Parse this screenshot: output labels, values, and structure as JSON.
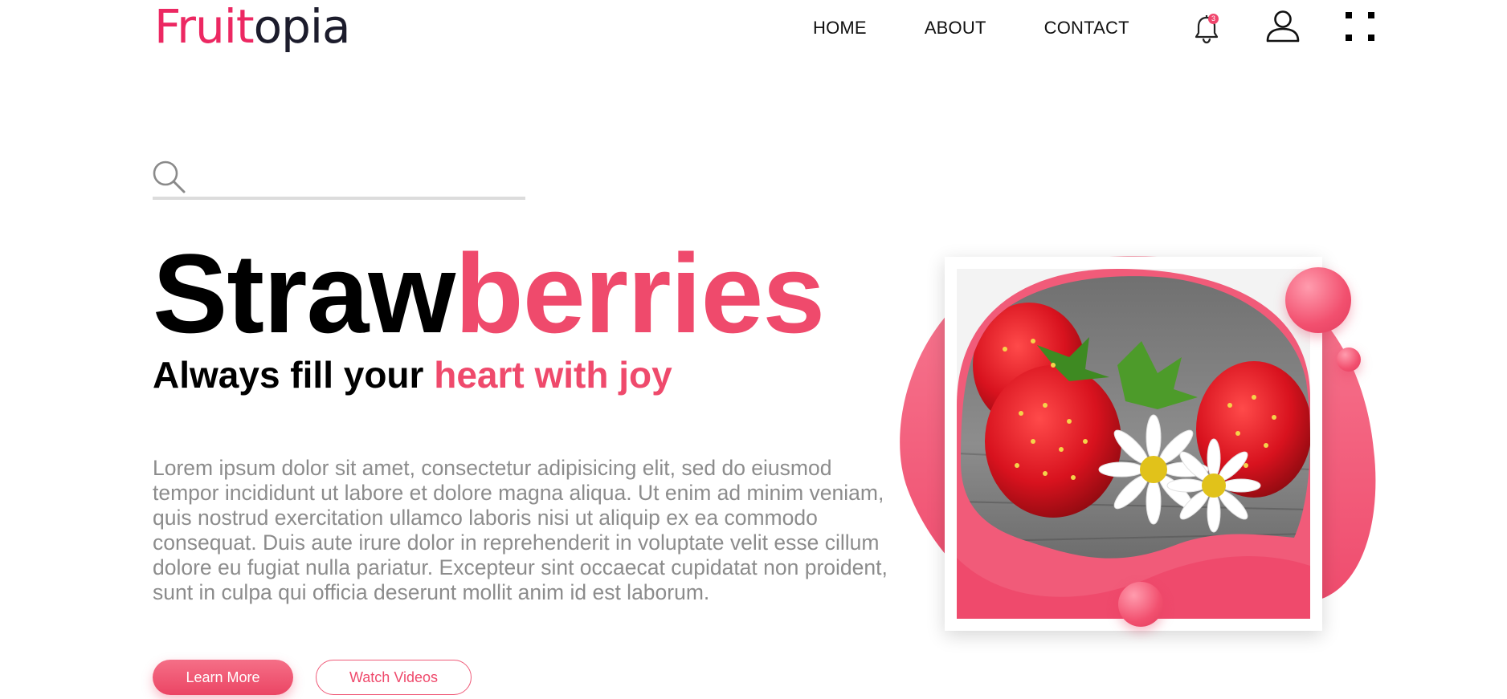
{
  "brand": {
    "logo_part1": "Fruit",
    "logo_part2": "opia",
    "accent_color": "#ec2862",
    "text_color": "#1c1c2c"
  },
  "nav": {
    "items": [
      {
        "label": "HOME"
      },
      {
        "label": "ABOUT"
      },
      {
        "label": "CONTACT"
      }
    ]
  },
  "header_icons": {
    "notifications": {
      "icon": "bell-icon",
      "badge": "3"
    },
    "account": {
      "icon": "user-icon"
    },
    "menu": {
      "icon": "grid-icon"
    }
  },
  "search": {
    "icon": "search-icon",
    "value": "",
    "placeholder": ""
  },
  "hero": {
    "title_black": "Straw",
    "title_pink": "berries",
    "subtitle_black": "Always fill your ",
    "subtitle_pink": "heart with joy",
    "body": "Lorem ipsum dolor sit amet, consectetur adipisicing elit, sed do eiusmod tempor incididunt ut labore et dolore magna aliqua. Ut enim ad minim veniam, quis nostrud exercitation ullamco laboris nisi ut aliquip ex ea commodo consequat. Duis aute irure dolor in reprehenderit in voluptate velit esse cillum dolore eu fugiat nulla pariatur. Excepteur sint occaecat cupidatat non proident, sunt in culpa qui officia deserunt mollit anim id est laborum.",
    "primary_button": "Learn More",
    "secondary_button": "Watch Videos",
    "pink_color": "#ef4a6c"
  },
  "hero_image": {
    "subject": "strawberries-with-daisies"
  }
}
